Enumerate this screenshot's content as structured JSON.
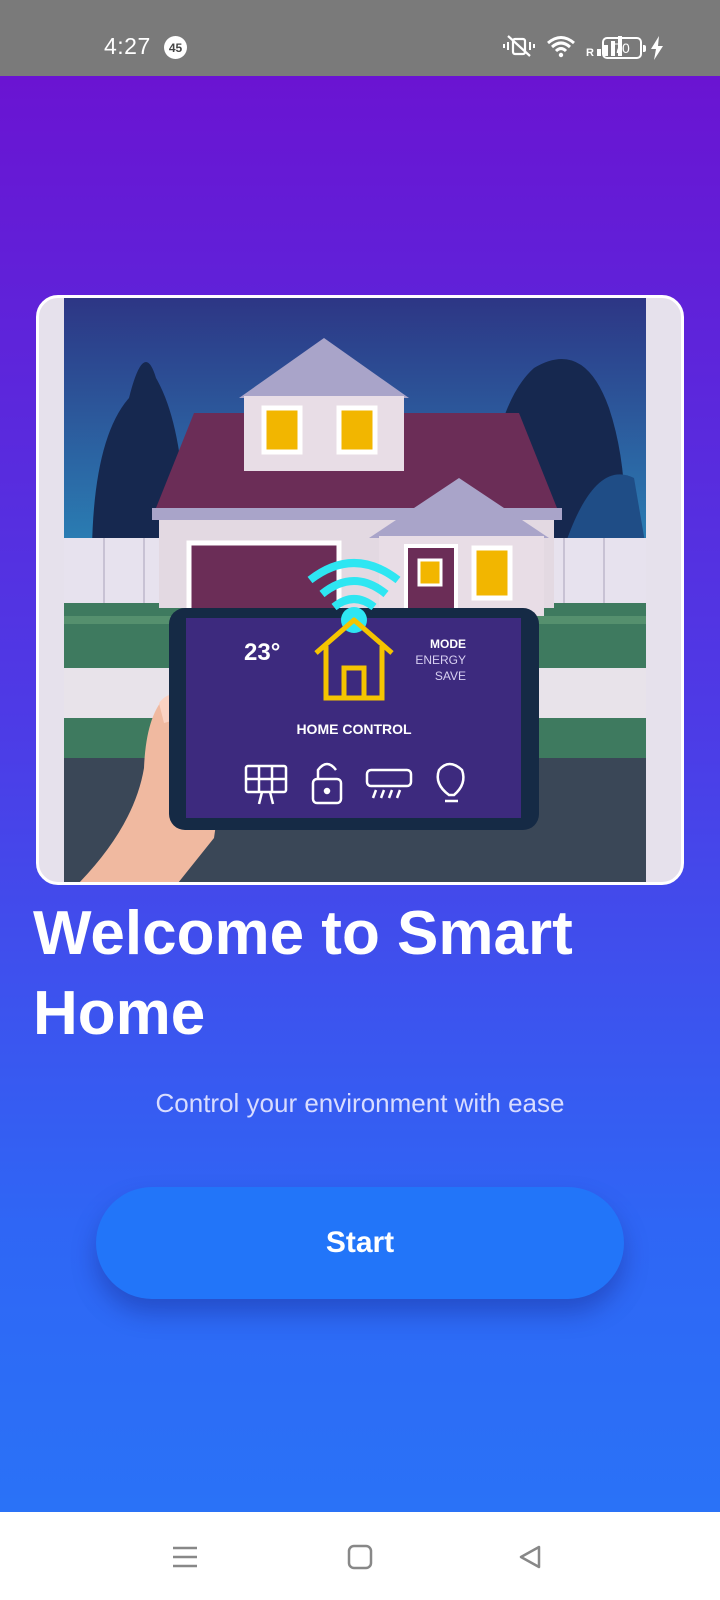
{
  "status_bar": {
    "time": "4:27",
    "notification_count": "45",
    "battery_level": "70",
    "icons": [
      "mute-vibrate-icon",
      "wifi-icon",
      "signal-icon",
      "battery-icon",
      "charging-icon"
    ],
    "roaming_label": "R"
  },
  "hero": {
    "image": "smart-home-house-illustration",
    "device": {
      "temperature": "23°",
      "mode_label": "MODE",
      "mode_value_line1": "ENERGY",
      "mode_value_line2": "SAVE",
      "title": "HOME CONTROL",
      "icons": [
        "solar-panel-icon",
        "unlock-icon",
        "air-conditioner-icon",
        "light-bulb-icon"
      ]
    }
  },
  "welcome": {
    "title": "Welcome to Smart Home",
    "subtitle": "Control your environment with ease"
  },
  "actions": {
    "start_label": "Start"
  },
  "colors": {
    "gradient_top": "#6a14d2",
    "gradient_bottom": "#2a72f7",
    "button": "#2275f9",
    "status_bar": "#7a7a7a"
  },
  "nav_bar": {
    "icons": [
      "menu-icon",
      "home-icon",
      "back-icon"
    ]
  }
}
